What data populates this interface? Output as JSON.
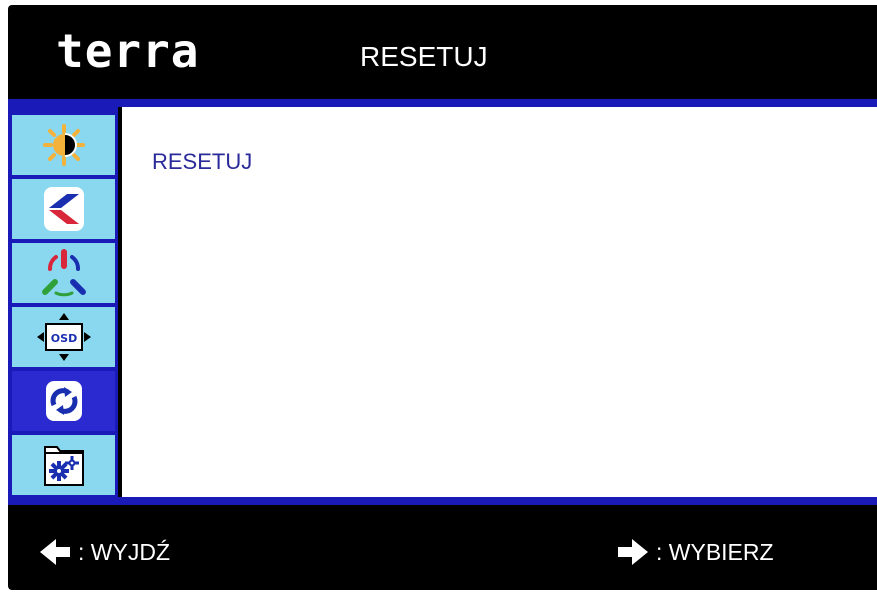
{
  "header": {
    "logo_text": "terra",
    "title": "RESETUJ"
  },
  "sidebar": {
    "items": [
      {
        "icon": "brightness-contrast-icon",
        "selected": false
      },
      {
        "icon": "image-settings-icon",
        "selected": false
      },
      {
        "icon": "color-icon",
        "selected": false
      },
      {
        "icon": "osd-position-icon",
        "selected": false
      },
      {
        "icon": "reset-icon",
        "selected": true
      },
      {
        "icon": "misc-settings-icon",
        "selected": false
      }
    ]
  },
  "content": {
    "label": "RESETUJ"
  },
  "footer": {
    "exit_label": ": WYJDŹ",
    "select_label": ": WYBIERZ"
  },
  "colors": {
    "background": "#000000",
    "accent_blue": "#1a1ab8",
    "tile_light": "#8ad8f0",
    "tile_selected": "#2a2ad0",
    "content_text": "#2a2a9a"
  }
}
